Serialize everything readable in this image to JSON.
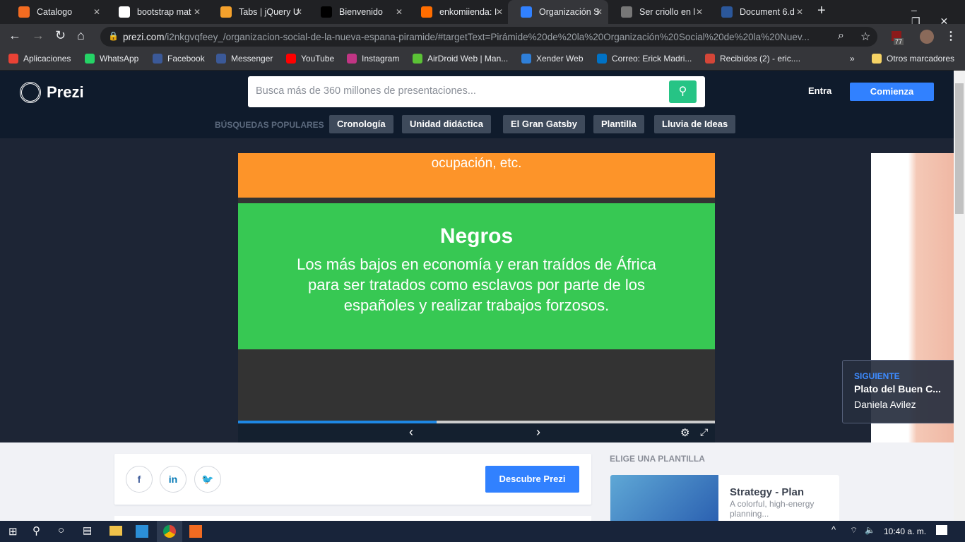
{
  "browser": {
    "tabs": [
      {
        "title": "Catalogo",
        "color": "#f26b21"
      },
      {
        "title": "bootstrap mat",
        "color": "#ffffff"
      },
      {
        "title": "Tabs | jQuery U",
        "color": "#f4a12c"
      },
      {
        "title": "Bienvenido",
        "color": "#000000"
      },
      {
        "title": "enkomiienda: I",
        "color": "#ff6d00"
      },
      {
        "title": "Organización S",
        "color": "#3181ff",
        "active": true
      },
      {
        "title": "Ser criollo en l",
        "color": "#777777"
      },
      {
        "title": "Document 6.d",
        "color": "#2b579a"
      }
    ],
    "url_host": "prezi.com",
    "url_path": "/i2nkgvqfeey_/organizacion-social-de-la-nueva-espana-piramide/#targetText=Pirámide%20de%20la%20Organización%20Social%20de%20la%20Nuev...",
    "extension_badge": "77",
    "bookmarks": [
      "Aplicaciones",
      "WhatsApp",
      "Facebook",
      "Messenger",
      "YouTube",
      "Instagram",
      "AirDroid Web | Man...",
      "Xender Web",
      "Correo: Erick Madri...",
      "Recibidos (2) - eric...."
    ],
    "bookmark_colors": [
      "#e94235",
      "#25d366",
      "#3b5998",
      "#3b5998",
      "#ff0000",
      "#c13584",
      "#5bc236",
      "#2f7fd8",
      "#0072c6",
      "#d44638"
    ],
    "more_bookmarks": "»",
    "other_bookmarks": "Otros marcadores"
  },
  "prezi": {
    "logo": "Prezi",
    "search_placeholder": "Busca más de 360 millones de presentaciones...",
    "login": "Entra",
    "signup": "Comienza",
    "popular_label": "BÚSQUEDAS POPULARES",
    "popular": [
      "Cronología",
      "Unidad didáctica",
      "El Gran Gatsby",
      "Plantilla",
      "Lluvia de Ideas"
    ]
  },
  "slide": {
    "orange_text": "ocupación, etc.",
    "title": "Negros",
    "body": "Los más bajos en economía y eran traídos  de África para ser tratados como esclavos por parte de los españoles y realizar trabajos forzosos.",
    "progress_percent": 41.6
  },
  "next": {
    "label": "SIGUIENTE",
    "title": "Plato del Buen C...",
    "author": "Daniela Avilez"
  },
  "share": {
    "discover": "Descubre Prezi"
  },
  "templates": {
    "heading": "ELIGE UNA PLANTILLA",
    "items": [
      {
        "title": "Strategy - Plan",
        "desc": "A colorful, high-energy planning..."
      }
    ]
  },
  "taskbar": {
    "time": "10:40 a. m."
  }
}
